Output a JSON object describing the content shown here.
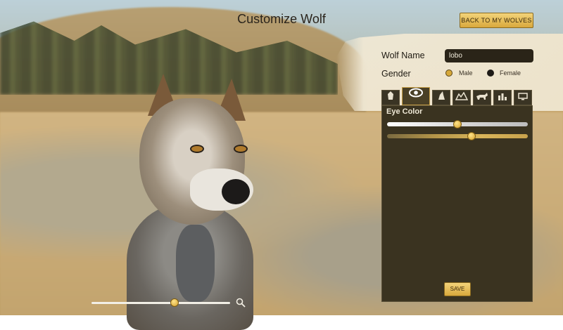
{
  "header": {
    "title": "Customize Wolf",
    "back_button": "BACK TO MY WOLVES"
  },
  "form": {
    "name_label": "Wolf Name",
    "name_value": "lobo",
    "gender_label": "Gender",
    "gender_options": [
      "Male",
      "Female"
    ],
    "gender_selected": "Male"
  },
  "tabs": [
    {
      "icon": "fur-icon"
    },
    {
      "icon": "eye-icon",
      "active": true
    },
    {
      "icon": "howl-icon"
    },
    {
      "icon": "terrain-icon"
    },
    {
      "icon": "wolf-pose-icon"
    },
    {
      "icon": "stats-icon"
    },
    {
      "icon": "monitor-icon"
    }
  ],
  "panel": {
    "title": "Eye Color",
    "sliders": [
      {
        "name": "eye-brightness-slider",
        "value": 0.5
      },
      {
        "name": "eye-hue-slider",
        "value": 0.6
      }
    ],
    "save_button": "SAVE"
  },
  "zoom": {
    "value": 0.6
  }
}
